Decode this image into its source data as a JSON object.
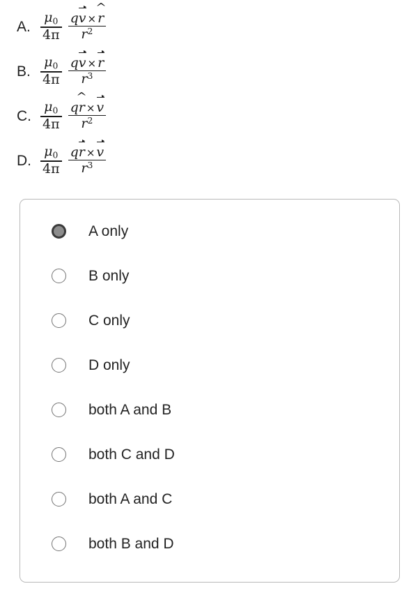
{
  "question_choices": {
    "items": [
      {
        "letter": "A.",
        "numerator": "q v⃗ × r̂",
        "denominator": "r²",
        "constant_numerator": "μ₀",
        "constant_denominator": "4π",
        "q": "q",
        "first_symbol": "v",
        "first_accent": "vector",
        "second_symbol": "r",
        "second_accent": "hat",
        "power": "2"
      },
      {
        "letter": "B.",
        "numerator": "q v⃗ × r⃗",
        "denominator": "r³",
        "constant_numerator": "μ₀",
        "constant_denominator": "4π",
        "q": "q",
        "first_symbol": "v",
        "first_accent": "vector",
        "second_symbol": "r",
        "second_accent": "vector",
        "power": "3"
      },
      {
        "letter": "C.",
        "numerator": "q r̂ × v⃗",
        "denominator": "r²",
        "constant_numerator": "μ₀",
        "constant_denominator": "4π",
        "q": "q",
        "first_symbol": "r",
        "first_accent": "hat",
        "second_symbol": "v",
        "second_accent": "vector",
        "power": "2"
      },
      {
        "letter": "D.",
        "numerator": "q r⃗ × v⃗",
        "denominator": "r³",
        "constant_numerator": "μ₀",
        "constant_denominator": "4π",
        "q": "q",
        "first_symbol": "r",
        "first_accent": "vector",
        "second_symbol": "v",
        "second_accent": "vector",
        "power": "3"
      }
    ],
    "mu_symbol": "μ",
    "mu_subscript": "0",
    "denominator_constant": "4π",
    "base_symbol": "r",
    "cross_symbol": "×"
  },
  "answer_card": {
    "selected_index": 0,
    "border_color": "#b9b9b9",
    "selected_ring_color": "#3a3a3a",
    "selected_fill_color": "#8d8d8d",
    "radio_color": "#737373",
    "label_color": "#222222",
    "options": [
      {
        "label": "A only",
        "selected": true
      },
      {
        "label": "B only",
        "selected": false
      },
      {
        "label": "C only",
        "selected": false
      },
      {
        "label": "D only",
        "selected": false
      },
      {
        "label": "both A and B",
        "selected": false
      },
      {
        "label": "both C and D",
        "selected": false
      },
      {
        "label": "both A and C",
        "selected": false
      },
      {
        "label": "both B and D",
        "selected": false
      }
    ]
  }
}
